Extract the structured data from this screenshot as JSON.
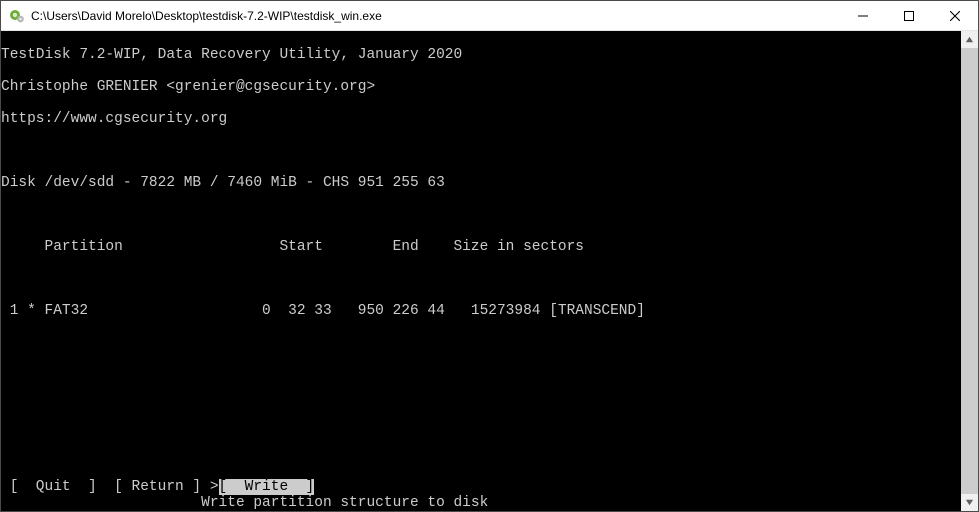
{
  "window": {
    "title": "C:\\Users\\David Morelo\\Desktop\\testdisk-7.2-WIP\\testdisk_win.exe"
  },
  "header": {
    "l1": "TestDisk 7.2-WIP, Data Recovery Utility, January 2020",
    "l2": "Christophe GRENIER <grenier@cgsecurity.org>",
    "l3": "https://www.cgsecurity.org"
  },
  "disk_line": "Disk /dev/sdd - 7822 MB / 7460 MiB - CHS 951 255 63",
  "table_header": "     Partition                  Start        End    Size in sectors",
  "partition_row": " 1 * FAT32                    0  32 33   950 226 44   15273984 [TRANSCEND]",
  "menu": {
    "pre": " [  Quit  ]  [ Return ] ",
    "sel_marker": ">",
    "selected": "[  Write  ]"
  },
  "help": "                       Write partition structure to disk"
}
